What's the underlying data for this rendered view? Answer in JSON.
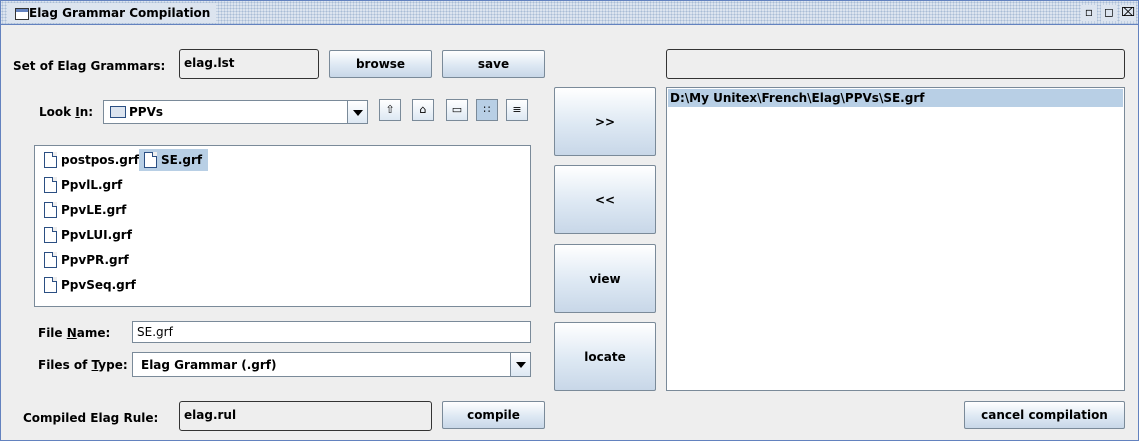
{
  "window": {
    "title": "Elag Grammar Compilation"
  },
  "grammars": {
    "label": "Set of Elag Grammars:",
    "value": "elag.lst",
    "browse_label": "browse",
    "save_label": "save"
  },
  "chooser": {
    "look_in_label_pre": "Look ",
    "look_in_label_u": "I",
    "look_in_label_post": "n:",
    "look_in_value": "PPVs",
    "files": [
      "postpos.grf",
      "SE.grf",
      "PpvlL.grf",
      "PpvLE.grf",
      "PpvLUI.grf",
      "PpvPR.grf",
      "PpvSeq.grf"
    ],
    "selected_file": "SE.grf",
    "file_name_label_pre": "File ",
    "file_name_label_u": "N",
    "file_name_label_post": "ame:",
    "file_name_value": "SE.grf",
    "files_of_type_label_pre": "Files of ",
    "files_of_type_label_u": "T",
    "files_of_type_label_post": "ype:",
    "files_of_type_value": "Elag Grammar (.grf)"
  },
  "actions": {
    "add_label": ">>",
    "remove_label": "<<",
    "view_label": "view",
    "locate_label": "locate"
  },
  "selected": {
    "path_field": "",
    "items": [
      "D:\\My Unitex\\French\\Elag\\PPVs\\SE.grf"
    ]
  },
  "compile": {
    "label": "Compiled Elag Rule:",
    "value": "elag.rul",
    "compile_label": "compile",
    "cancel_label": "cancel compilation"
  },
  "colors": {
    "selection": "#b8cfe5",
    "border": "#6382bf",
    "background": "#eeeeee"
  }
}
